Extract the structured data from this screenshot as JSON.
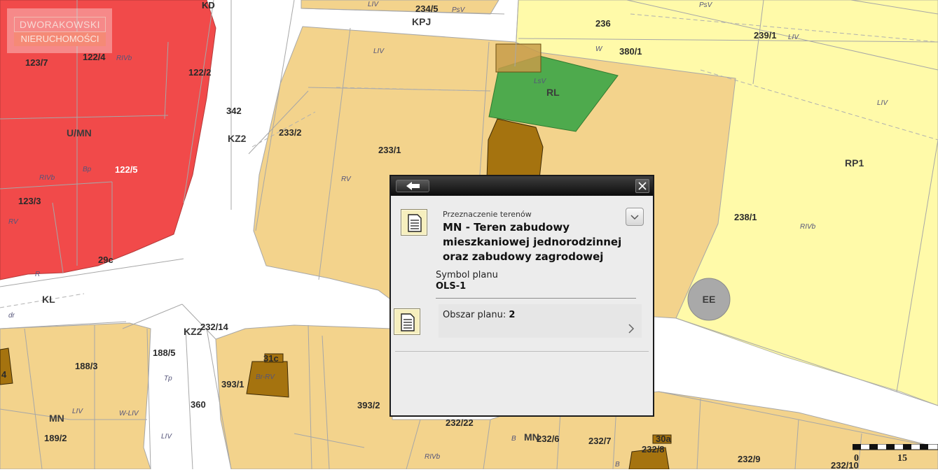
{
  "branding": {
    "logo_line1": "DWORAKOWSKI",
    "logo_line2": "NIERUCHOMOŚCI"
  },
  "map": {
    "colors": {
      "zone_um": "#f14a4a",
      "zone_mn": "#f3d38c",
      "zone_rp": "#fffaa9",
      "zone_rl": "#4eaa4d",
      "building": "#a5730f",
      "road": "#ffffff",
      "parcel_line": "#a7a7a7"
    },
    "labels": {
      "kd": "KD",
      "p2345": "234/5",
      "psv_top": "PsV",
      "liv_top": "LIV",
      "kpj": "KPJ",
      "p236": "236",
      "psv_r": "PsV",
      "p2391": "239/1",
      "liv_r1": "LIV",
      "w": "W",
      "p3801": "380/1",
      "liv_mn1": "LIV",
      "lsv": "LsV",
      "rl": "RL",
      "liv_r2": "LIV",
      "p1237": "123/7",
      "p1224": "122/4",
      "rivb_1": "RIVb",
      "p1222": "122/2",
      "p342": "342",
      "kz2_a": "KZ2",
      "p2332": "233/2",
      "p2331": "233/1",
      "rp1": "RP1",
      "umn": "U/MN",
      "rivb_2": "RIVb",
      "bp": "Bp",
      "p1225": "122/5",
      "rv_1": "RV",
      "p2381": "238/1",
      "rivb_r": "RIVb",
      "p1233": "123/3",
      "rv_2": "RV",
      "p29c": "29c",
      "r": "R",
      "kl": "KL",
      "dr": "dr",
      "ee": "EE",
      "kz2_b": "KZ2",
      "p23214": "232/14",
      "p1885": "188/5",
      "p31c": "31c",
      "brrv": "Br-RV",
      "p1883": "188/3",
      "tp": "Tp",
      "p3931": "393/1",
      "p4": "4",
      "p360": "360",
      "p3932": "393/2",
      "liv_b1": "LIV",
      "wliv": "W-LIV",
      "mn_l": "MN",
      "p1892": "189/2",
      "liv_b2": "LIV",
      "p23222": "232/22",
      "b1": "B",
      "mn_b": "MN",
      "p2326": "232/6",
      "p2327": "232/7",
      "p30a": "30a",
      "p2328": "232/8",
      "rivb_b": "RIVb",
      "b2": "B",
      "p2329": "232/9",
      "p23210": "232/10"
    },
    "scale": {
      "start": "0",
      "end": "15"
    }
  },
  "popup": {
    "caption": "Przeznaczenie terenów",
    "title": "MN - Teren zabudowy mieszkaniowej jednorodzinnej oraz zabudowy zagrodowej",
    "symbol_label": "Symbol planu",
    "symbol_value": "OLS-1",
    "area_label": "Obszar planu:",
    "area_value": "2",
    "icons": {
      "back": "arrow-left-icon",
      "close": "close-icon",
      "doc": "document-icon",
      "expand": "chevron-down-icon",
      "next": "chevron-right-icon"
    }
  }
}
